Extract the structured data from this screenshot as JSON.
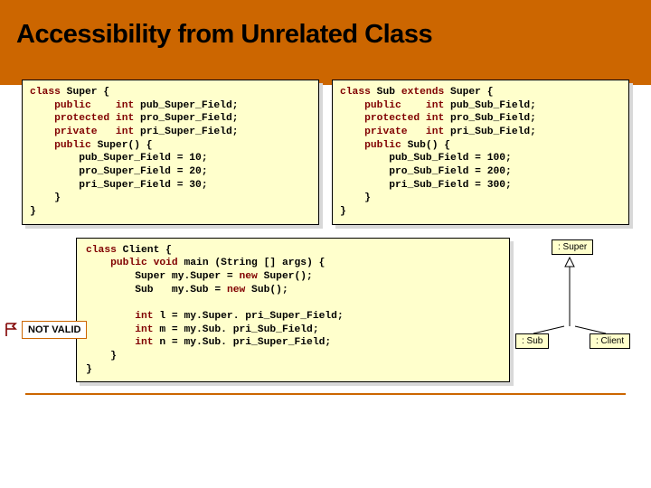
{
  "title": "Accessibility from Unrelated Class",
  "code_super": {
    "l1a": "class",
    "l1b": " Super {",
    "l2a": "    public    ",
    "l2b": "int",
    "l2c": " pub_Super_Field;",
    "l3a": "    protected ",
    "l3b": "int",
    "l3c": " pro_Super_Field;",
    "l4a": "    private   ",
    "l4b": "int",
    "l4c": " pri_Super_Field;",
    "l5a": "    public",
    "l5b": " Super() {",
    "l6": "        pub_Super_Field = 10;",
    "l7": "        pro_Super_Field = 20;",
    "l8": "        pri_Super_Field = 30;",
    "l9": "    }",
    "l10": "}"
  },
  "code_sub": {
    "l1a": "class",
    "l1b": " Sub ",
    "l1c": "extends",
    "l1d": " Super {",
    "l2a": "    public    ",
    "l2b": "int",
    "l2c": " pub_Sub_Field;",
    "l3a": "    protected ",
    "l3b": "int",
    "l3c": " pro_Sub_Field;",
    "l4a": "    private   ",
    "l4b": "int",
    "l4c": " pri_Sub_Field;",
    "l5a": "    public",
    "l5b": " Sub() {",
    "l6": "        pub_Sub_Field = 100;",
    "l7": "        pro_Sub_Field = 200;",
    "l8": "        pri_Sub_Field = 300;",
    "l9": "    }",
    "l10": "}"
  },
  "code_client": {
    "l1a": "class",
    "l1b": " Client {",
    "l2a": "    public void",
    "l2b": " main (String [] args) {",
    "l3a": "        Super my.Super = ",
    "l3b": "new",
    "l3c": " Super();",
    "l4a": "        Sub   my.Sub = ",
    "l4b": "new",
    "l4c": " Sub();",
    "l5": "",
    "l6a": "        int",
    "l6b": " l = my.Super. pri_Super_Field;",
    "l7a": "        int",
    "l7b": " m = my.Sub. pri_Sub_Field;",
    "l8a": "        int",
    "l8b": " n = my.Sub. pri_Super_Field;",
    "l9": "    }",
    "l10": "}"
  },
  "flag_label": "NOT VALID",
  "uml": {
    "super": ": Super",
    "sub": ": Sub",
    "client": ": Client"
  }
}
